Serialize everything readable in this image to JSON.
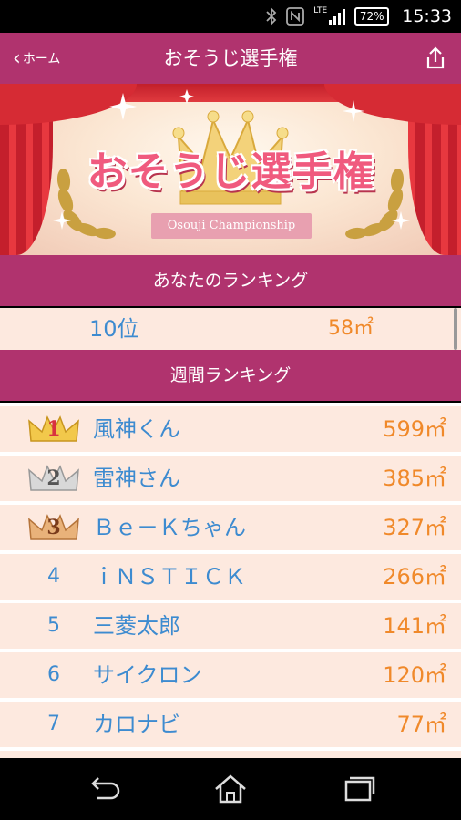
{
  "status_bar": {
    "battery": "72%",
    "network": "LTE",
    "time": "15:33"
  },
  "app_bar": {
    "back_label": "ホーム",
    "title": "おそうじ選手権"
  },
  "banner": {
    "logo_text": "おそうじ選手権",
    "subtitle": "Osouji Championship"
  },
  "my_ranking": {
    "header": "あなたのランキング",
    "rank": "10位",
    "area": "58㎡"
  },
  "weekly_ranking": {
    "header": "週間ランキング",
    "rows": [
      {
        "rank": "1",
        "name": "風神くん",
        "area": "599㎡",
        "crown": "gold"
      },
      {
        "rank": "2",
        "name": "雷神さん",
        "area": "385㎡",
        "crown": "silver"
      },
      {
        "rank": "3",
        "name": "Ｂｅ－Ｋちゃん",
        "area": "327㎡",
        "crown": "bronze"
      },
      {
        "rank": "4",
        "name": "ｉＮＳＴＩＣＫ",
        "area": "266㎡",
        "crown": ""
      },
      {
        "rank": "5",
        "name": "三菱太郎",
        "area": "141㎡",
        "crown": ""
      },
      {
        "rank": "6",
        "name": "サイクロン",
        "area": "120㎡",
        "crown": ""
      },
      {
        "rank": "7",
        "name": "カロナビ",
        "area": "77㎡",
        "crown": ""
      }
    ]
  },
  "colors": {
    "primary": "#b0336e",
    "row_bg": "#fde9df",
    "name": "#3d8bd0",
    "area": "#f0892a"
  },
  "icons": {
    "status": [
      "bluetooth-icon",
      "nfc-icon",
      "signal-icon",
      "battery-icon"
    ],
    "app_bar": [
      "chevron-left-icon",
      "share-icon"
    ],
    "nav": [
      "back-icon",
      "home-icon",
      "recent-apps-icon"
    ]
  }
}
